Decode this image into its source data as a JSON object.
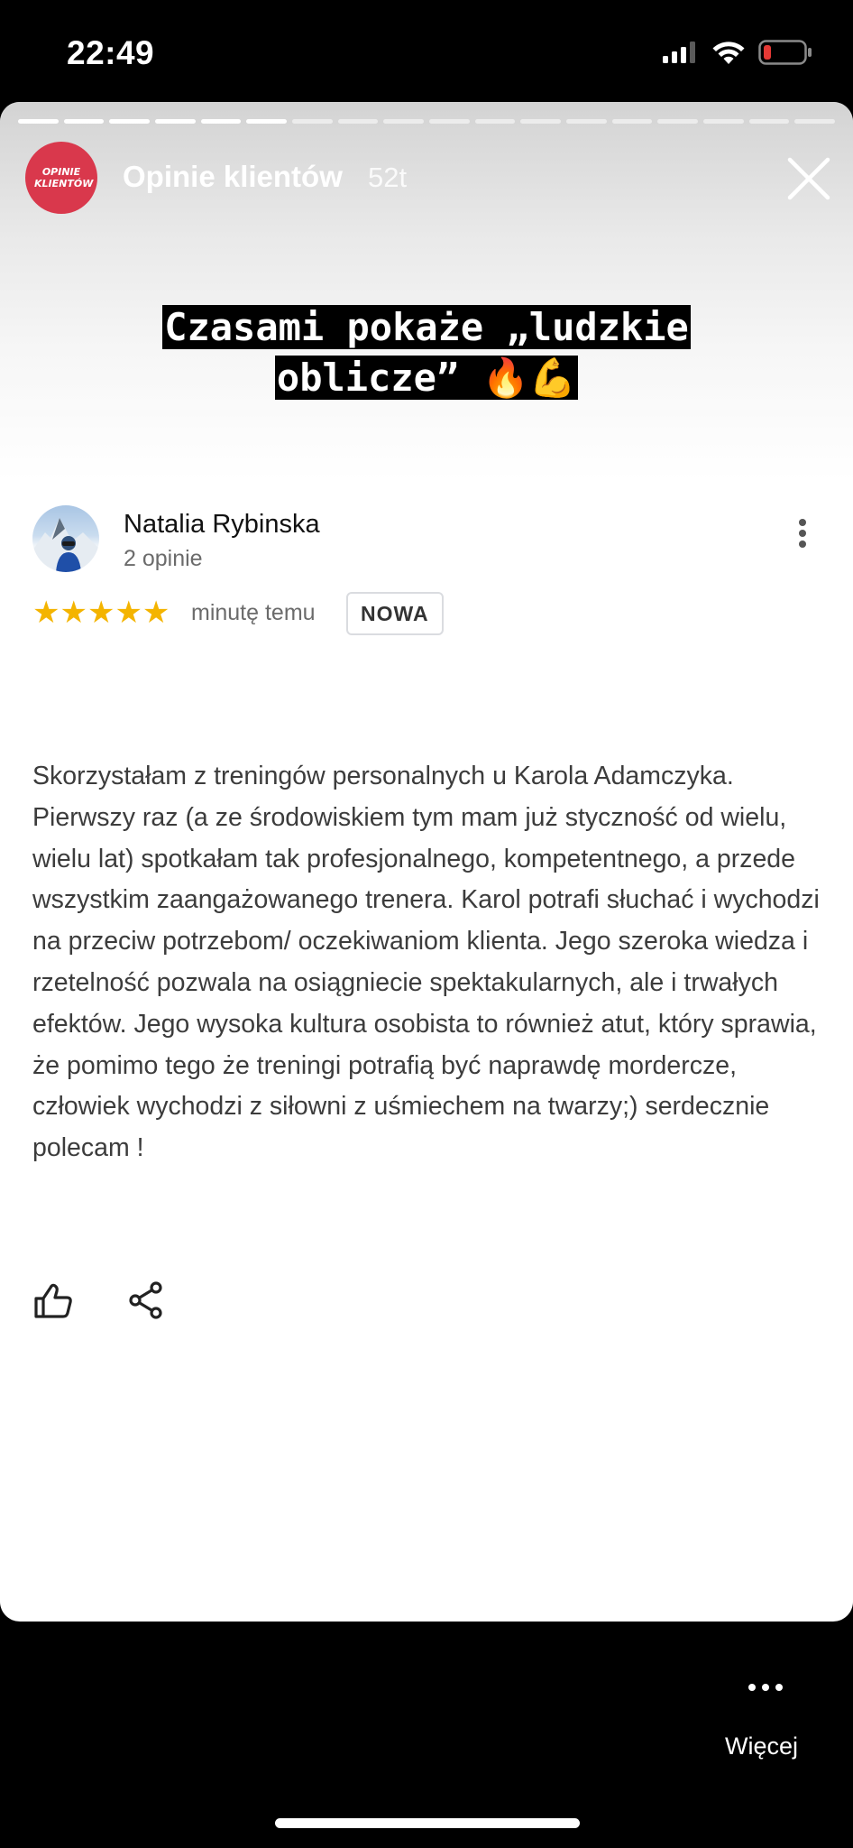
{
  "status_bar": {
    "time": "22:49",
    "icons": [
      "signal-icon",
      "wifi-icon",
      "battery-low-icon"
    ]
  },
  "story": {
    "account_name": "Opinie klientów",
    "account_logo_text": "OPINIE KLIENTÓW",
    "age": "52t",
    "progress": {
      "segments": 18,
      "completed": 6
    },
    "caption_line1": "Czasami pokaże „ludzkie",
    "caption_line2": "oblicze” 🔥💪"
  },
  "review": {
    "author": "Natalia Rybinska",
    "author_meta": "2 opinie",
    "rating": 5,
    "stars": "★★★★★",
    "time": "minutę temu",
    "badge": "NOWA",
    "text": "Skorzystałam z treningów personalnych u Karola Adamczyka. Pierwszy raz (a ze środowiskiem tym mam już styczność od wielu, wielu lat) spotkałam tak profesjonalnego, kompetentnego, a przede wszystkim zaangażowanego trenera. Karol potrafi słuchać i wychodzi na przeciw potrzebom/ oczekiwaniom klienta. Jego szeroka wiedza i rzetelność pozwala na osiągniecie spektakularnych, ale i trwałych efektów. Jego wysoka kultura osobista to również atut, który sprawia, że pomimo tego że treningi potrafią być naprawdę mordercze, człowiek wychodzi z siłowni z uśmiechem na twarzy;) serdecznie polecam !",
    "actions": [
      "thumbs-up-icon",
      "share-icon"
    ]
  },
  "footer": {
    "more_label": "Więcej"
  },
  "colors": {
    "star": "#f4b400",
    "brand": "#d9384c",
    "battery_low": "#e53935"
  }
}
